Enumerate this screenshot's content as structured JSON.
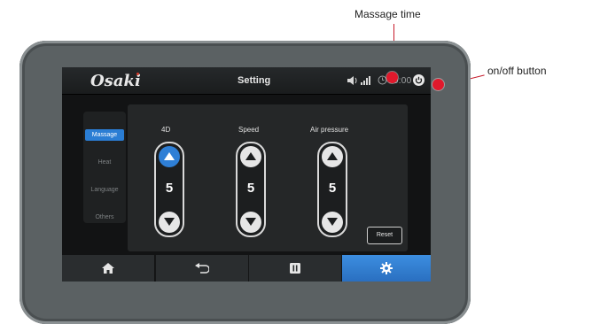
{
  "annotations": {
    "massage_time": "Massage time",
    "onoff_button": "on/off button"
  },
  "header": {
    "logo": "Osaki",
    "title": "Setting",
    "timer": "00:00"
  },
  "side_menu": {
    "items": [
      {
        "label": "Massage",
        "active": true
      },
      {
        "label": "Heat",
        "active": false
      },
      {
        "label": "Language",
        "active": false
      },
      {
        "label": "Others",
        "active": false
      }
    ]
  },
  "controls": [
    {
      "label": "4D",
      "value": "5",
      "up_highlighted": true
    },
    {
      "label": "Speed",
      "value": "5",
      "up_highlighted": false
    },
    {
      "label": "Air pressure",
      "value": "5",
      "up_highlighted": false
    }
  ],
  "reset_label": "Reset",
  "bottom_nav": {
    "tabs": [
      "home-icon",
      "back-icon",
      "pause-icon",
      "gear-icon"
    ],
    "active_tab": "gear-icon"
  },
  "colors": {
    "accent_blue": "#2e7fd6",
    "callout_red": "#e0192c",
    "device_frame": "#5b6163"
  }
}
